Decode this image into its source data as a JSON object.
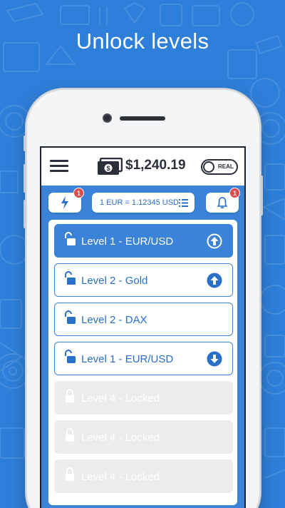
{
  "headline": "Unlock levels",
  "app": {
    "balance": "$1,240.19",
    "account_mode": "REAL",
    "rate": "1 EUR = 1.12345 USD",
    "flash_badge": "1",
    "notification_badge": "1"
  },
  "levels": [
    {
      "label": "Level 1 - EUR/USD",
      "state": "active",
      "arrow": "up-arrow-icon"
    },
    {
      "label": "Level 2 - Gold",
      "state": "unlocked",
      "arrow": "up-arrow-icon"
    },
    {
      "label": "Level 2 - DAX",
      "state": "unlocked",
      "arrow": ""
    },
    {
      "label": "Level 1 - EUR/USD",
      "state": "unlocked",
      "arrow": "down-arrow-icon"
    },
    {
      "label": "Level 4 - Locked",
      "state": "locked",
      "arrow": ""
    },
    {
      "label": "Level 4 - Locked",
      "state": "locked",
      "arrow": ""
    },
    {
      "label": "Level 4 - Locked",
      "state": "locked",
      "arrow": ""
    }
  ],
  "colors": {
    "background": "#2e7fd9",
    "accent": "#3a83d8",
    "badge": "#e24b4b",
    "locked": "#ececee"
  }
}
